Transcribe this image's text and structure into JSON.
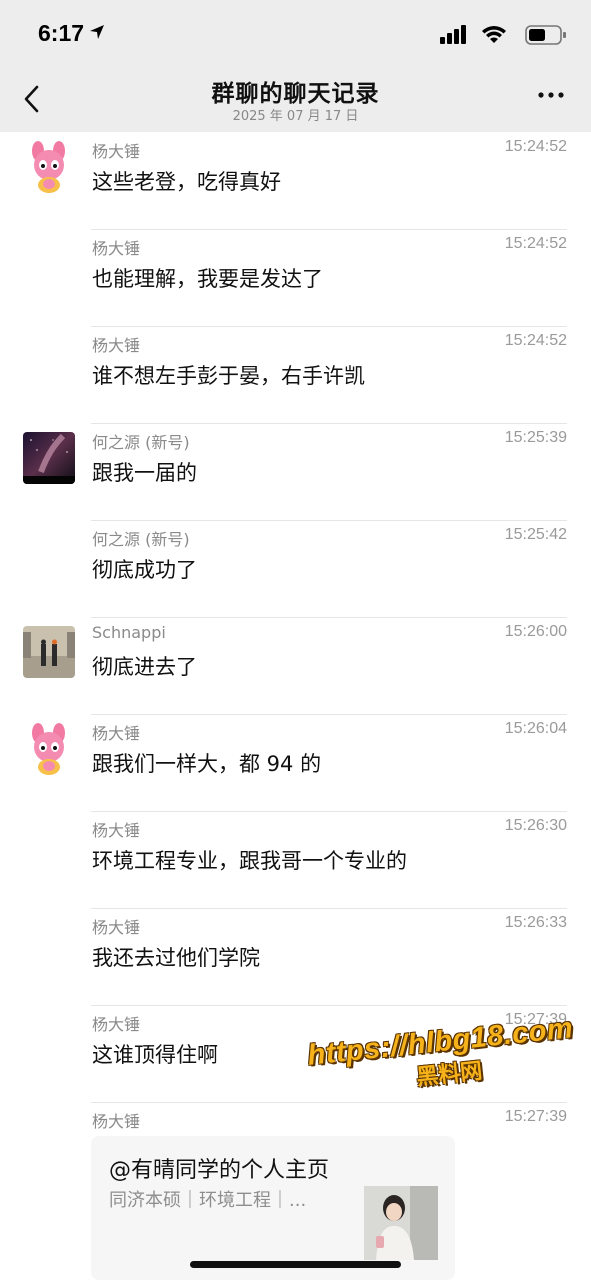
{
  "status_bar": {
    "time": "6:17"
  },
  "nav": {
    "title": "群聊的聊天记录",
    "subtitle": "2025 年 07 月 17 日",
    "back_icon": "chevron-left-icon",
    "more_icon": "ellipsis-icon"
  },
  "messages": [
    {
      "sender": "杨大锤",
      "time": "15:24:52",
      "text": "这些老登，吃得真好",
      "avatar": "pink-rabbit-avatar"
    },
    {
      "sender": "杨大锤",
      "time": "15:24:52",
      "text": "也能理解，我要是发达了",
      "avatar": ""
    },
    {
      "sender": "杨大锤",
      "time": "15:24:52",
      "text": "谁不想左手彭于晏，右手许凯",
      "avatar": ""
    },
    {
      "sender": "何之源 (新号)",
      "time": "15:25:39",
      "text": "跟我一届的",
      "avatar": "starry-sky-avatar"
    },
    {
      "sender": "何之源 (新号)",
      "time": "15:25:42",
      "text": "彻底成功了",
      "avatar": ""
    },
    {
      "sender": "Schnappi",
      "time": "15:26:00",
      "text": "彻底进去了",
      "avatar": "handshake-photo-avatar"
    },
    {
      "sender": "杨大锤",
      "time": "15:26:04",
      "text": "跟我们一样大，都 94 的",
      "avatar": "pink-rabbit-avatar"
    },
    {
      "sender": "杨大锤",
      "time": "15:26:30",
      "text": "环境工程专业，跟我哥一个专业的",
      "avatar": ""
    },
    {
      "sender": "杨大锤",
      "time": "15:26:33",
      "text": "我还去过他们学院",
      "avatar": ""
    },
    {
      "sender": "杨大锤",
      "time": "15:27:39",
      "text": "这谁顶得住啊",
      "avatar": ""
    }
  ],
  "last_message": {
    "sender": "杨大锤",
    "time": "15:27:39",
    "card": {
      "title": "@有晴同学的个人主页",
      "desc": "同济本硕｜环境工程｜...",
      "thumb": "profile-photo"
    }
  },
  "watermark": {
    "url": "https://hlbg18.com",
    "site": "黑料网"
  },
  "colors": {
    "header_bg": "#ededed",
    "page_bg": "#ffffff",
    "sender_text": "#8a8a8a",
    "message_text": "#111111",
    "watermark": "#f6b21a"
  }
}
